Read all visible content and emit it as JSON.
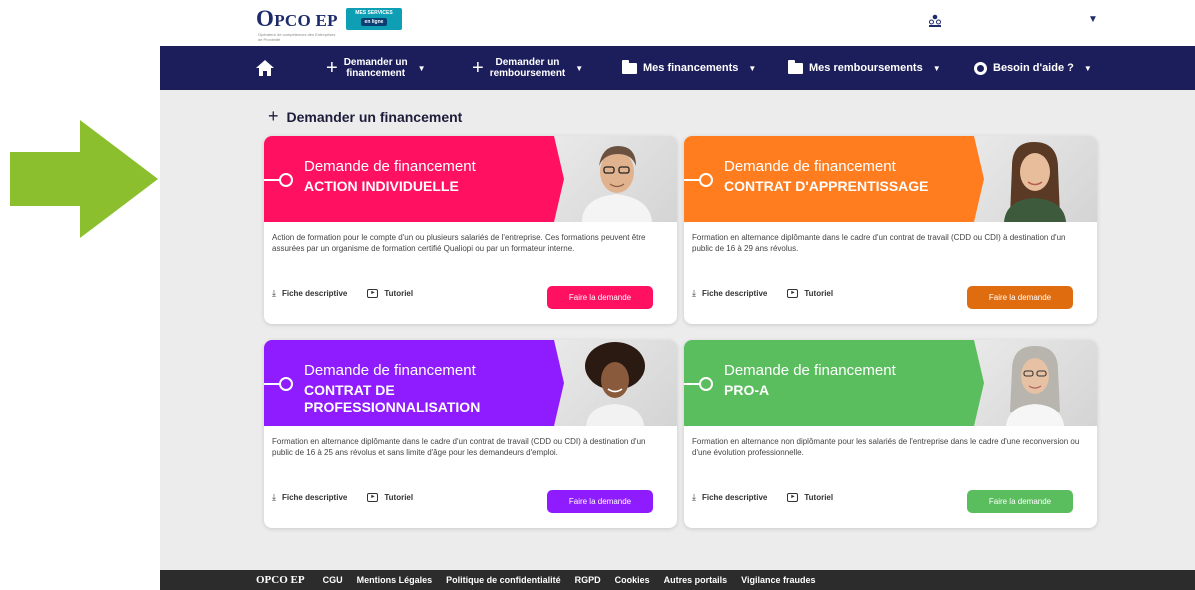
{
  "colors": {
    "navy": "#1c1e5c",
    "arrow": "#8cbf2d",
    "pink": "#ff1060",
    "orange": "#ff7d1f",
    "purple": "#8f1cff",
    "green": "#5abd5e"
  },
  "header": {
    "logo": "OPCO EP",
    "logo_sub": "Opérateur de compétences des Entreprises de Proximité",
    "mes_services": "MES SERVICES",
    "mes_services_badge": "en ligne",
    "user_icon": "users-icon"
  },
  "nav": {
    "home_icon": "home-icon",
    "items": [
      {
        "label_line1": "Demander un",
        "label_line2": "financement"
      },
      {
        "label_line1": "Demander un",
        "label_line2": "remboursement"
      },
      {
        "label": "Mes financements"
      },
      {
        "label": "Mes remboursements"
      },
      {
        "label": "Besoin d'aide ?"
      }
    ]
  },
  "section_title": "Demander un financement",
  "cards": [
    {
      "line1": "Demande de financement",
      "line2": "ACTION INDIVIDUELLE",
      "description": "Action de formation pour le compte d'un ou plusieurs salariés de l'entreprise. Ces formations peuvent être assurées par un organisme de formation certifié Qualiopi ou par un formateur interne.",
      "fiche": "Fiche descriptive",
      "tutoriel": "Tutoriel",
      "button": "Faire la demande",
      "color": "#ff1060",
      "photo": "man-glasses-photo"
    },
    {
      "line1": "Demande de financement",
      "line2": "CONTRAT D'APPRENTISSAGE",
      "description": "Formation en alternance diplômante dans le cadre d'un contrat de travail (CDD ou CDI) à destination d'un public de 16 à 29 ans révolus.",
      "fiche": "Fiche descriptive",
      "tutoriel": "Tutoriel",
      "button": "Faire la demande",
      "color": "#ff7d1f",
      "button_color": "#e06c10",
      "photo": "young-woman-photo"
    },
    {
      "line1": "Demande de financement",
      "line2": "CONTRAT DE PROFESSIONNALISATION",
      "description": "Formation en alternance diplômante dans le cadre d'un contrat de travail (CDD ou CDI) à destination d'un public de 16 à 25 ans révolus et sans limite d'âge pour les demandeurs d'emploi.",
      "fiche": "Fiche descriptive",
      "tutoriel": "Tutoriel",
      "button": "Faire la demande",
      "color": "#8f1cff",
      "photo": "curly-hair-woman-photo"
    },
    {
      "line1": "Demande de financement",
      "line2": "PRO-A",
      "description": "Formation en alternance non diplômante pour les salariés de l'entreprise dans le cadre d'une reconversion ou d'une évolution professionnelle.",
      "fiche": "Fiche descriptive",
      "tutoriel": "Tutoriel",
      "button": "Faire la demande",
      "color": "#5abd5e",
      "photo": "grey-hair-woman-photo"
    }
  ],
  "footer": {
    "logo": "OPCO EP",
    "links": [
      "CGU",
      "Mentions Légales",
      "Politique de confidentialité",
      "RGPD",
      "Cookies",
      "Autres portails",
      "Vigilance fraudes"
    ]
  }
}
